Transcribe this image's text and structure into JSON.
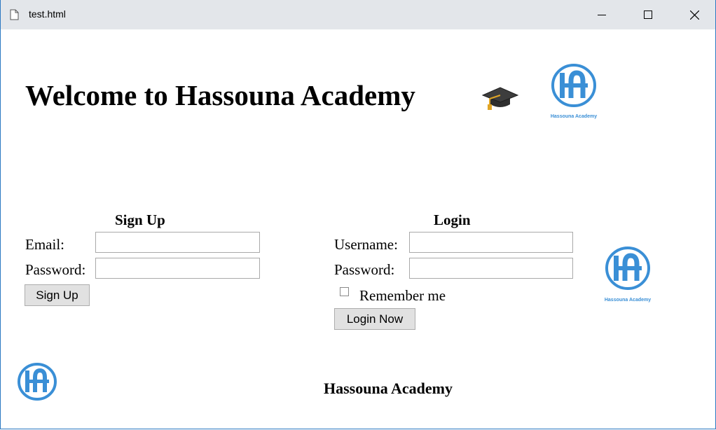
{
  "window": {
    "title": "test.html",
    "file_icon": "document-icon",
    "controls": [
      "minimize-icon",
      "maximize-icon",
      "close-icon"
    ]
  },
  "header": {
    "title": "Welcome to Hassouna Academy",
    "icon": "graduation-cap-icon"
  },
  "logo": {
    "brand_text": "Hassouna Academy",
    "color": "#3a8fd6"
  },
  "signup": {
    "title": "Sign Up",
    "email_label": "Email:",
    "password_label": "Password:",
    "email_value": "",
    "password_value": "",
    "button_label": "Sign Up"
  },
  "login": {
    "title": "Login",
    "username_label": "Username:",
    "password_label": "Password:",
    "username_value": "",
    "password_value": "",
    "remember_label": "Remember me",
    "button_label": "Login Now"
  },
  "footer": {
    "text": "Hassouna Academy"
  }
}
